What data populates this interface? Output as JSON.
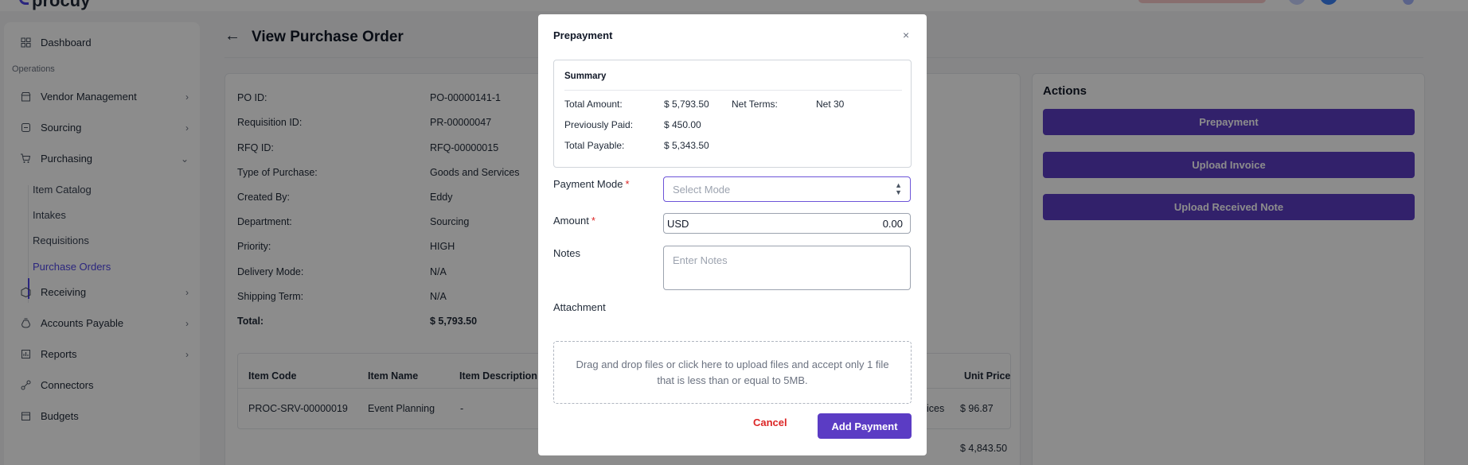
{
  "app": {
    "brand": "procuy"
  },
  "sidebar": {
    "section_operations": "Operations",
    "items": {
      "dashboard": "Dashboard",
      "vendor_management": "Vendor Management",
      "sourcing": "Sourcing",
      "purchasing": "Purchasing",
      "receiving": "Receiving",
      "accounts_payable": "Accounts Payable",
      "reports": "Reports",
      "connectors": "Connectors",
      "budgets": "Budgets"
    },
    "purchasing_sub": {
      "item_catalog": "Item Catalog",
      "intakes": "Intakes",
      "requisitions": "Requisitions",
      "purchase_orders": "Purchase Orders"
    }
  },
  "page": {
    "title": "View Purchase Order",
    "po_fields": {
      "po_id_label": "PO ID:",
      "po_id": "PO-00000141-1",
      "req_label": "Requisition ID:",
      "req": "PR-00000047",
      "rfq_label": "RFQ ID:",
      "rfq": "RFQ-00000015",
      "type_label": "Type of Purchase:",
      "type": "Goods and Services",
      "created_label": "Created By:",
      "created": "Eddy",
      "dept_label": "Department:",
      "dept": "Sourcing",
      "priority_label": "Priority:",
      "priority": "HIGH",
      "delivery_label": "Delivery Mode:",
      "delivery": "N/A",
      "shipping_label": "Shipping Term:",
      "shipping": "N/A",
      "total_label": "Total:",
      "total": "$ 5,793.50"
    },
    "table": {
      "headers": {
        "item_code": "Item Code",
        "item_name": "Item Name",
        "item_desc": "Item Description",
        "unit_price": "Unit Price"
      },
      "row": {
        "item_code": "PROC-SRV-00000019",
        "item_name": "Event Planning",
        "item_desc": "-",
        "category_tail": "ices",
        "unit_price": "$ 96.87"
      },
      "subtotal": "$ 4,843.50"
    },
    "actions": {
      "title": "Actions",
      "prepayment": "Prepayment",
      "upload_invoice": "Upload Invoice",
      "upload_received_note": "Upload Received Note"
    }
  },
  "modal": {
    "title": "Prepayment",
    "close_glyph": "×",
    "summary": {
      "title": "Summary",
      "total_amount_label": "Total Amount:",
      "total_amount": "$ 5,793.50",
      "net_terms_label": "Net Terms:",
      "net_terms": "Net 30",
      "prev_paid_label": "Previously Paid:",
      "prev_paid": "$ 450.00",
      "total_payable_label": "Total Payable:",
      "total_payable": "$ 5,343.50"
    },
    "payment_mode_label": "Payment Mode",
    "payment_mode_placeholder": "Select Mode",
    "amount_label": "Amount",
    "amount_currency": "USD",
    "amount_value": "0.00",
    "notes_label": "Notes",
    "notes_placeholder": "Enter Notes",
    "attachment_label": "Attachment",
    "dropzone_text": "Drag and drop files or click here to upload files and accept only 1 file that is less than or equal to 5MB.",
    "required_mark": "*",
    "cancel": "Cancel",
    "add_payment": "Add Payment"
  }
}
